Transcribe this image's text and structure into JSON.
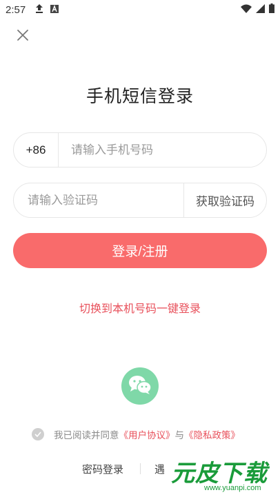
{
  "status_bar": {
    "time": "2:57",
    "icons": [
      "upload-icon",
      "a-box-icon",
      "wifi-icon",
      "signal-icon",
      "battery-icon"
    ]
  },
  "header": {
    "close_icon": "close-icon",
    "title": "手机短信登录"
  },
  "form": {
    "country_code": "+86",
    "phone_placeholder": "请输入手机号码",
    "code_placeholder": "请输入验证码",
    "get_code_label": "获取验证码",
    "submit_label": "登录/注册"
  },
  "switch_link": "切换到本机号码一键登录",
  "wechat": {
    "icon": "wechat-icon",
    "color": "#7fd8a8"
  },
  "agreement": {
    "prefix": "我已阅读并同意",
    "user_agreement": "《用户协议》",
    "and": "与",
    "privacy_policy": "《隐私政策》"
  },
  "bottom": {
    "password_login": "密码登录",
    "other_partial": "遇"
  },
  "watermark": {
    "main": "元皮下载",
    "sub": "www.yuanpi.com"
  },
  "colors": {
    "accent": "#f96b6b",
    "link": "#e8505b",
    "wechat": "#7fd8a8",
    "watermark": "#1a9b3a"
  }
}
